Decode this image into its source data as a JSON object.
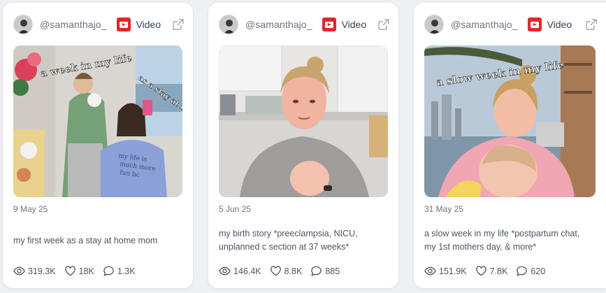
{
  "cards": [
    {
      "handle": "@samanthajo_",
      "platform": "Video",
      "platform_icon": "youtube-icon",
      "overlay_text": "a week in my life as a stay at ho",
      "date": "9 May 25",
      "description": "my first week as a stay at home mom",
      "views": "319.3K",
      "likes": "18K",
      "comments": "1.3K"
    },
    {
      "handle": "@samanthajo_",
      "platform": "Video",
      "platform_icon": "youtube-icon",
      "date": "5 Jun 25",
      "description": "my birth story *preeclampsia, NICU, unplanned c section at 37 weeks*",
      "views": "146.4K",
      "likes": "8.8K",
      "comments": "885"
    },
    {
      "handle": "@samanthajo_",
      "platform": "Video",
      "platform_icon": "youtube-icon",
      "overlay_text": "a slow week in my life",
      "date": "31 May 25",
      "description": "a slow week in my life *postpartum chat, my 1st mothers day, & more*",
      "views": "151.9K",
      "likes": "7.8K",
      "comments": "620"
    }
  ],
  "colors": {
    "youtube_red": "#e3262b",
    "card_bg": "#ffffff",
    "page_bg": "#eef0f4",
    "muted_text": "#6b7280"
  }
}
